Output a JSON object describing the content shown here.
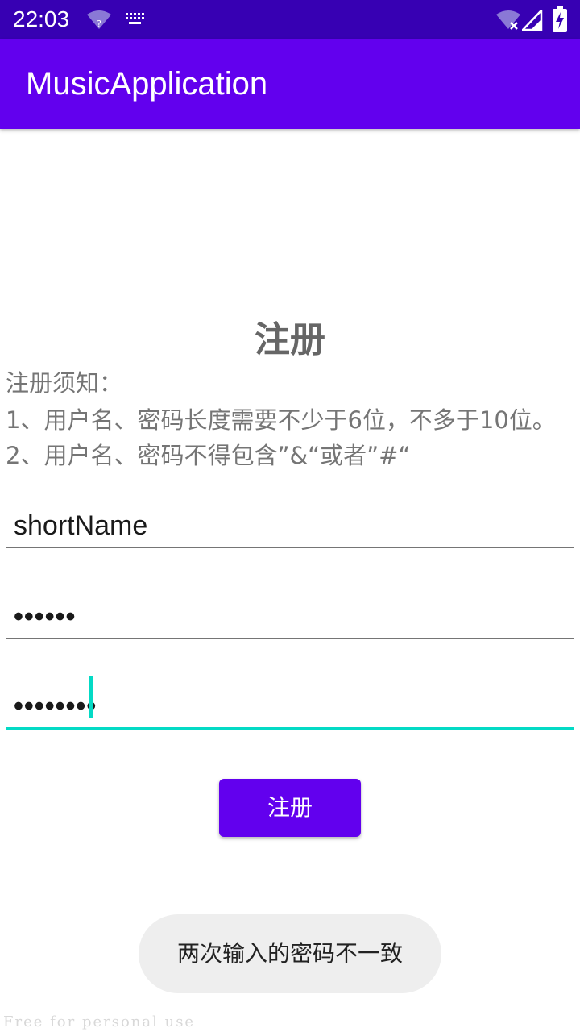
{
  "status_bar": {
    "time": "22:03",
    "icons": [
      "wifi-question-icon",
      "keyboard-icon",
      "wifi-off-icon",
      "signal-icon",
      "battery-charging-icon"
    ]
  },
  "app_bar": {
    "title": "MusicApplication",
    "color": "#6200ee",
    "status_bar_color": "#3700b3"
  },
  "page": {
    "heading": "注册",
    "notice_title": "注册须知：",
    "notice_rules": [
      "1、用户名、密码长度需要不少于6位，不多于10位。",
      "2、用户名、密码不得包含”&“或者”#“"
    ]
  },
  "form": {
    "username_value": "shortName",
    "password_masked": "••••••",
    "confirm_password_masked": "••••••••",
    "focused_field": "confirm_password",
    "accent_color": "#03dac5",
    "submit_label": "注册"
  },
  "toast": {
    "message": "两次输入的密码不一致"
  },
  "watermark": {
    "text": "Free for personal use"
  }
}
